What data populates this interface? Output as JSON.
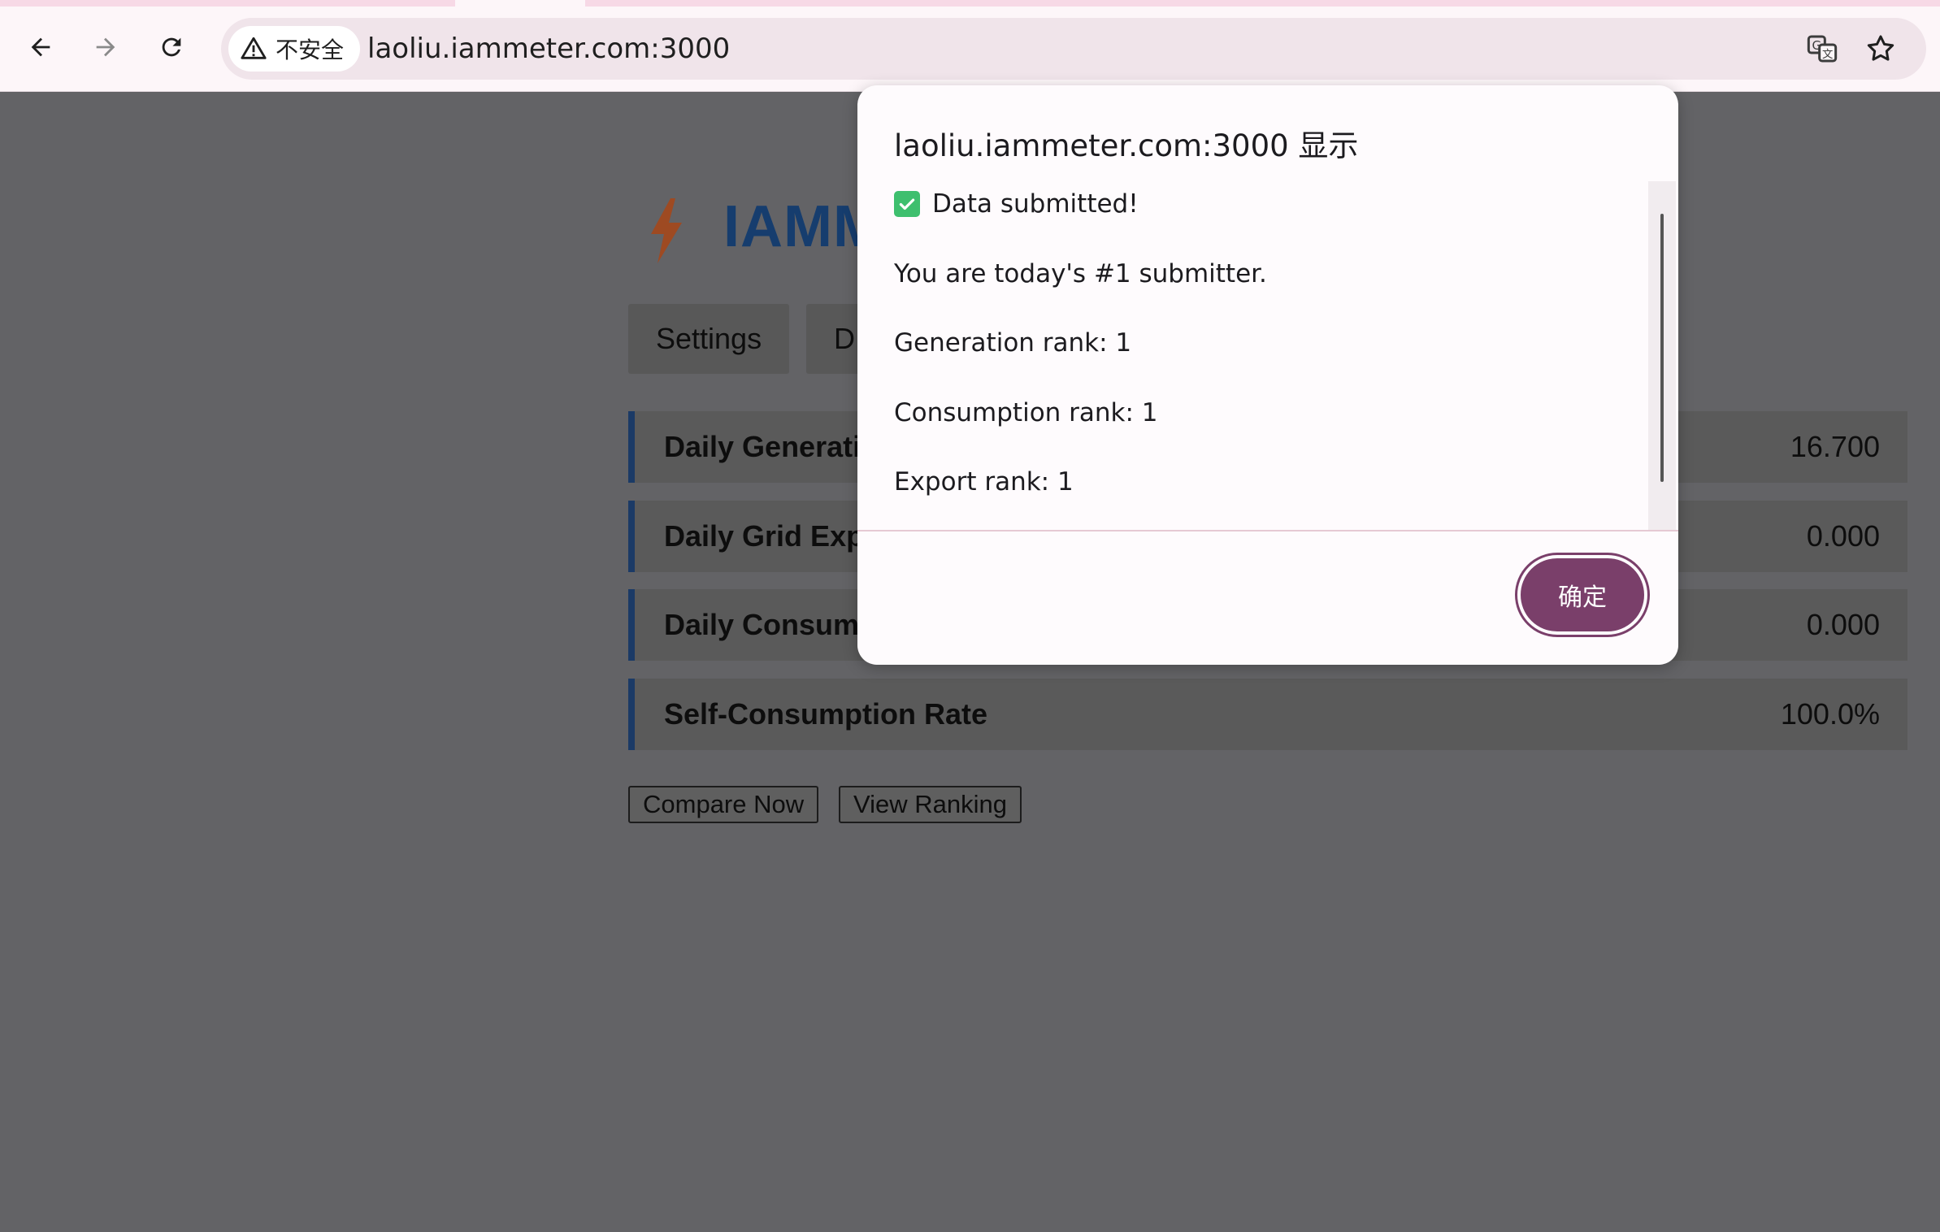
{
  "browser": {
    "security_label": "不安全",
    "url": "laoliu.iammeter.com:3000"
  },
  "page": {
    "logo_text": "IAMM",
    "tabs": [
      {
        "label": "Settings"
      },
      {
        "label": "D"
      }
    ],
    "metrics": [
      {
        "label": "Daily Generati",
        "value": "16.700"
      },
      {
        "label": "Daily Grid Exp",
        "value": "0.000"
      },
      {
        "label": "Daily Consum",
        "value": "0.000"
      },
      {
        "label": "Self-Consumption Rate",
        "value": "100.0%"
      }
    ],
    "buttons": {
      "compare": "Compare Now",
      "ranking": "View Ranking"
    }
  },
  "dialog": {
    "title": "laoliu.iammeter.com:3000 显示",
    "lines": [
      "Data submitted!",
      "You are today's #1 submitter.",
      "Generation rank: 1",
      "Consumption rank: 1",
      "Export rank: 1"
    ],
    "ok_label": "确定"
  },
  "colors": {
    "accent": "#7a3f6a",
    "success": "#3ebf6e",
    "metric_border": "#1b3a66",
    "logo": "#163d6e"
  },
  "icons": {
    "back": "arrow-left-icon",
    "forward": "arrow-right-icon",
    "reload": "reload-icon",
    "warning": "warning-icon",
    "translate": "translate-icon",
    "bookmark": "star-icon",
    "check": "check-icon",
    "bolt": "lightning-bolt-icon"
  }
}
